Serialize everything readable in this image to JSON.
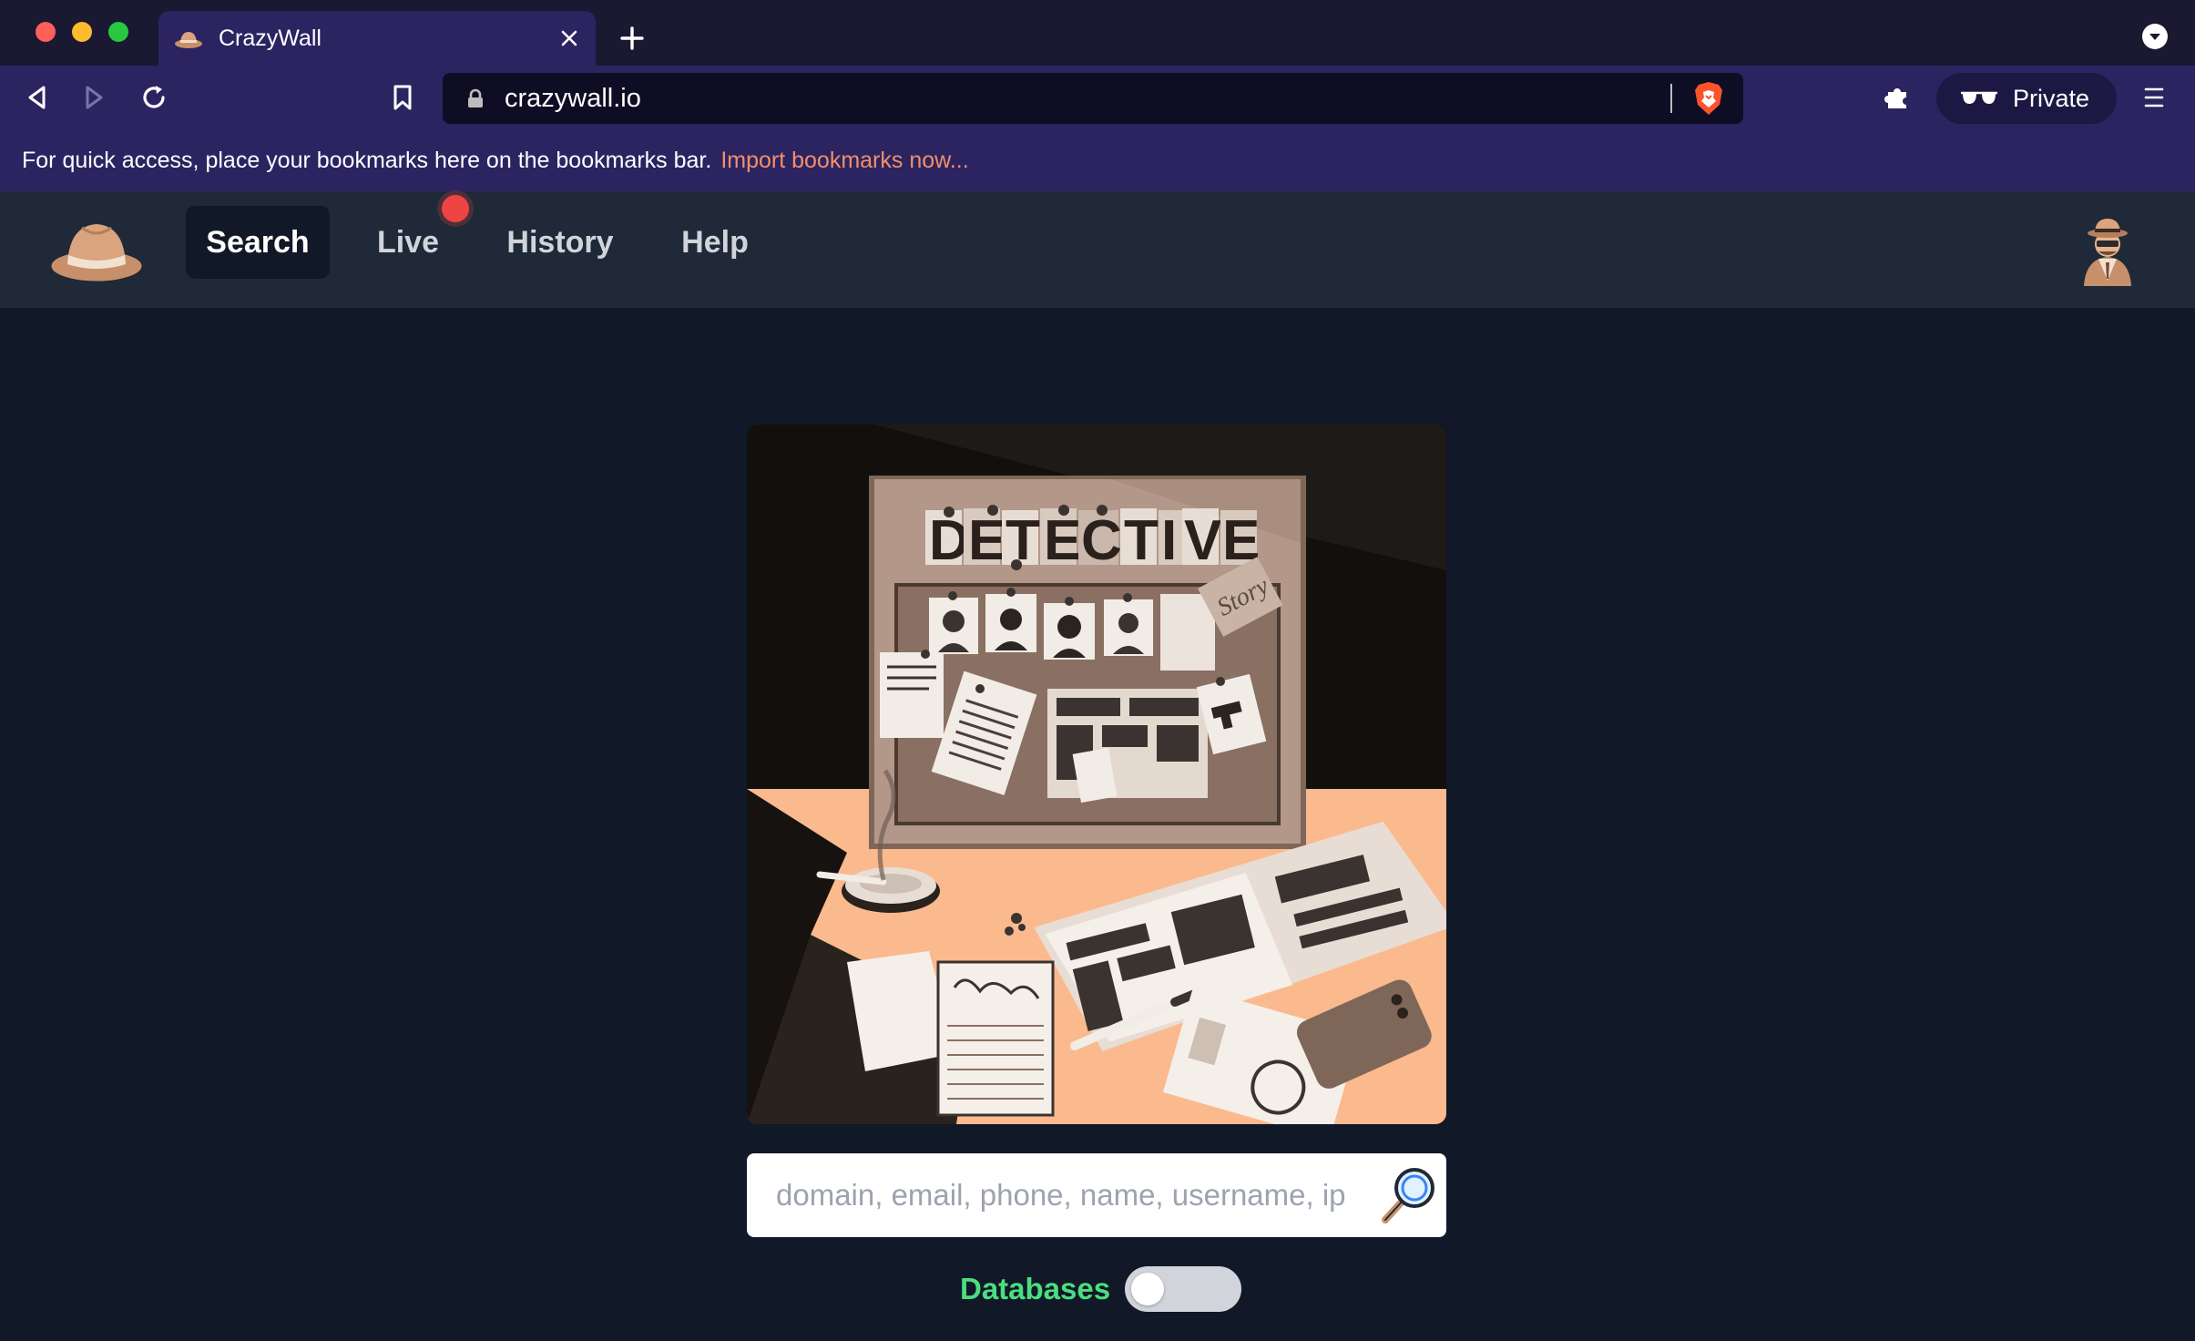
{
  "browser": {
    "tab": {
      "title": "CrazyWall",
      "favicon": "detective-hat-icon"
    },
    "url": "crazywall.io",
    "private_label": "Private",
    "bookmarks_bar": {
      "message": "For quick access, place your bookmarks here on the bookmarks bar.",
      "link": "Import bookmarks now..."
    },
    "colors": {
      "tabbar": "#1b1832",
      "toolbar": "#2b2461",
      "active_tab": "#2b2461",
      "link": "#f58e6a"
    }
  },
  "site": {
    "nav": {
      "items": [
        {
          "label": "Search",
          "active": true
        },
        {
          "label": "Live",
          "active": false,
          "indicator": "live-dot"
        },
        {
          "label": "History",
          "active": false
        },
        {
          "label": "Help",
          "active": false
        }
      ]
    },
    "hero_image": {
      "icon": "detective-board-illustration",
      "board_letters": [
        "D",
        "E",
        "T",
        "E",
        "C",
        "T",
        "I",
        "V",
        "E"
      ],
      "story_note": "Story"
    },
    "search": {
      "placeholder": "domain, email, phone, name, username, ip",
      "value": ""
    },
    "databases_toggle": {
      "label": "Databases",
      "on": false
    },
    "colors": {
      "background": "#111827",
      "nav_background": "#1f2937",
      "accent_green": "#4ade80",
      "live_red": "#ef4444"
    }
  }
}
